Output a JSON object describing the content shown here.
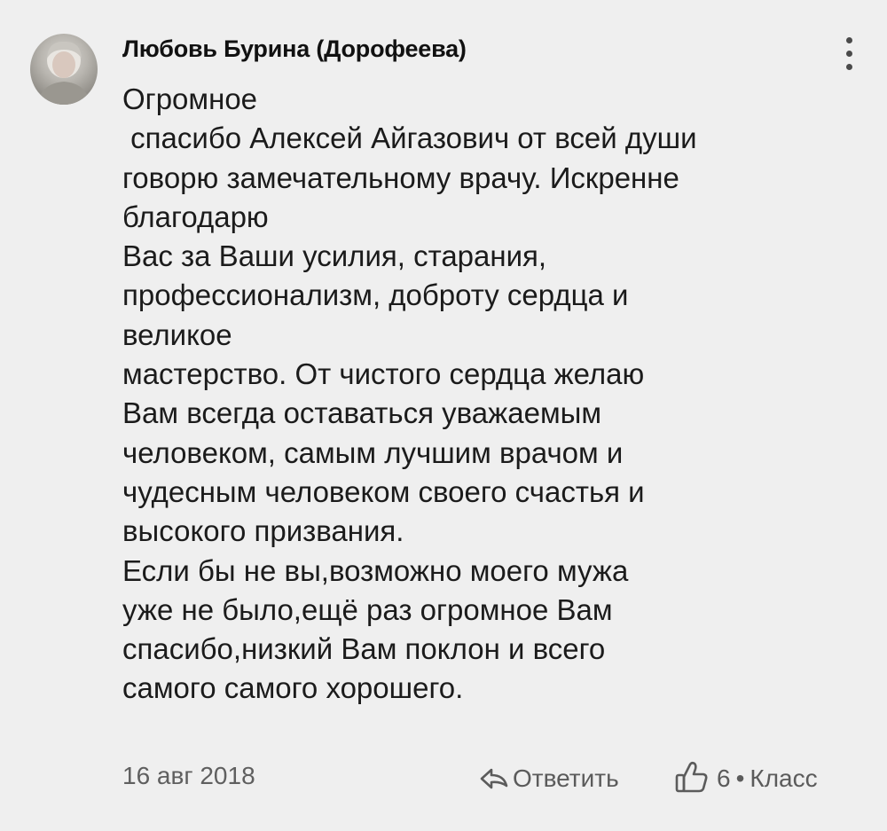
{
  "comment": {
    "author": "Любовь Бурина (Дорофеева)",
    "text_lines": [
      "Огромное",
      " спасибо Алексей Айгазович от всей души",
      "говорю замечательному врачу. Искренне",
      "благодарю",
      "Вас за Ваши усилия, старания,",
      "профессионализм, доброту сердца и",
      "великое",
      "мастерство. От чистого сердца желаю",
      "Вам всегда оставаться уважаемым",
      "человеком, самым лучшим врачом и",
      "чудесным человеком своего счастья и",
      "высокого призвания.",
      "Если бы не вы,возможно моего мужа",
      "уже не было,ещё раз огромное Вам",
      "спасибо,низкий Вам поклон и всего",
      "самого самого хорошего."
    ],
    "date": "16 авг 2018",
    "reply_label": "Ответить",
    "like_count": "6",
    "separator": "•",
    "like_label": "Класс",
    "icons": {
      "menu": "more-vertical-icon",
      "reply": "reply-arrow-icon",
      "like": "thumbs-up-icon"
    }
  }
}
